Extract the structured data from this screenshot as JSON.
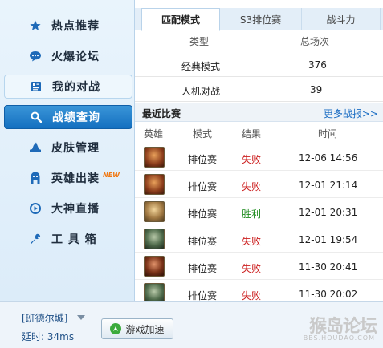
{
  "sidebar": {
    "items": [
      {
        "label": "热点推荐",
        "icon": "star-icon"
      },
      {
        "label": "火爆论坛",
        "icon": "chat-bubble-icon"
      },
      {
        "label": "我的对战",
        "icon": "battle-icon"
      },
      {
        "label": "战绩查询",
        "icon": "search-icon"
      },
      {
        "label": "皮肤管理",
        "icon": "hat-icon"
      },
      {
        "label": "英雄出装",
        "icon": "hero-icon",
        "badge": "NEW"
      },
      {
        "label": "大神直播",
        "icon": "play-icon"
      },
      {
        "label": "工 具 箱",
        "icon": "wrench-icon"
      }
    ]
  },
  "tabs": [
    "匹配模式",
    "S3排位赛",
    "战斗力"
  ],
  "summary": {
    "headers": [
      "类型",
      "总场次"
    ],
    "rows": [
      {
        "type": "经典模式",
        "count": "376"
      },
      {
        "type": "人机对战",
        "count": "39"
      }
    ]
  },
  "recent": {
    "title": "最近比赛",
    "more": "更多战报>>",
    "headers": [
      "英雄",
      "模式",
      "结果",
      "时间"
    ],
    "rows": [
      {
        "mode": "排位赛",
        "result": "失败",
        "time": "12-06 14:56",
        "win": false
      },
      {
        "mode": "排位赛",
        "result": "失败",
        "time": "12-01 21:14",
        "win": false
      },
      {
        "mode": "排位赛",
        "result": "胜利",
        "time": "12-01 20:31",
        "win": true
      },
      {
        "mode": "排位赛",
        "result": "失败",
        "time": "12-01 19:54",
        "win": false
      },
      {
        "mode": "排位赛",
        "result": "失败",
        "time": "11-30 20:41",
        "win": false
      },
      {
        "mode": "排位赛",
        "result": "失败",
        "time": "11-30 20:02",
        "win": false
      }
    ]
  },
  "bottom": {
    "server": "[班德尔城]",
    "latency": "延时: 34ms",
    "accelerate": "游戏加速",
    "watermark": "猴岛论坛",
    "watermark_url": "BBS.HOUDAO.COM"
  },
  "colors": {
    "accent": "#1470c0",
    "lose": "#cc1f1f",
    "win": "#1c8a1c"
  }
}
